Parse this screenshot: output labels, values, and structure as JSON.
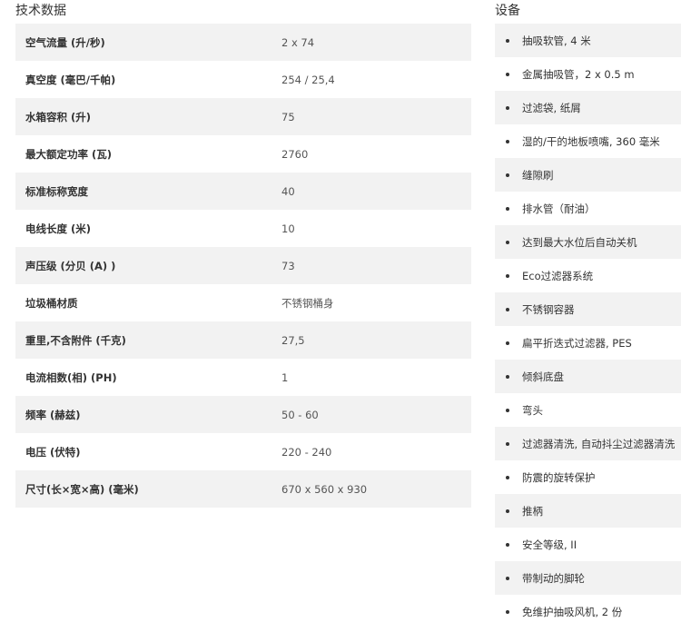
{
  "tech_section": {
    "title": "技术数据",
    "rows": [
      {
        "label": "空气流量 (升/秒)",
        "value": "2 x 74"
      },
      {
        "label": "真空度 (毫巴/千帕)",
        "value": "254 / 25,4"
      },
      {
        "label": "水箱容积 (升)",
        "value": "75"
      },
      {
        "label": "最大额定功率 (瓦)",
        "value": "2760"
      },
      {
        "label": "标准标称宽度",
        "value": "40"
      },
      {
        "label": "电线长度 (米)",
        "value": "10"
      },
      {
        "label": "声压级 (分贝 (A) )",
        "value": "73"
      },
      {
        "label": "垃圾桶材质",
        "value": "不锈钢桶身"
      },
      {
        "label": "重里,不含附件 (千克)",
        "value": "27,5"
      },
      {
        "label": "电流相数(相) (PH)",
        "value": "1"
      },
      {
        "label": "频率 (赫兹)",
        "value": "50 - 60"
      },
      {
        "label": "电压 (伏特)",
        "value": "220 - 240"
      },
      {
        "label": "尺寸(长×宽×高) (毫米)",
        "value": "670 x 560 x 930"
      }
    ]
  },
  "equip_section": {
    "title": "设备",
    "items": [
      "抽吸软管, 4 米",
      "金属抽吸管，2 x 0.5 m",
      "过滤袋, 纸屑",
      "湿的/干的地板喷嘴, 360 毫米",
      "缝隙刷",
      "排水管（耐油）",
      "达到最大水位后自动关机",
      "Eco过滤器系统",
      "不锈钢容器",
      "扁平折迭式过滤器, PES",
      "倾斜底盘",
      "弯头",
      "过滤器清洗, 自动抖尘过滤器清洗",
      "防震的旋转保护",
      "推柄",
      "安全等级, II",
      "带制动的脚轮",
      "免维护抽吸风机, 2 份"
    ]
  }
}
